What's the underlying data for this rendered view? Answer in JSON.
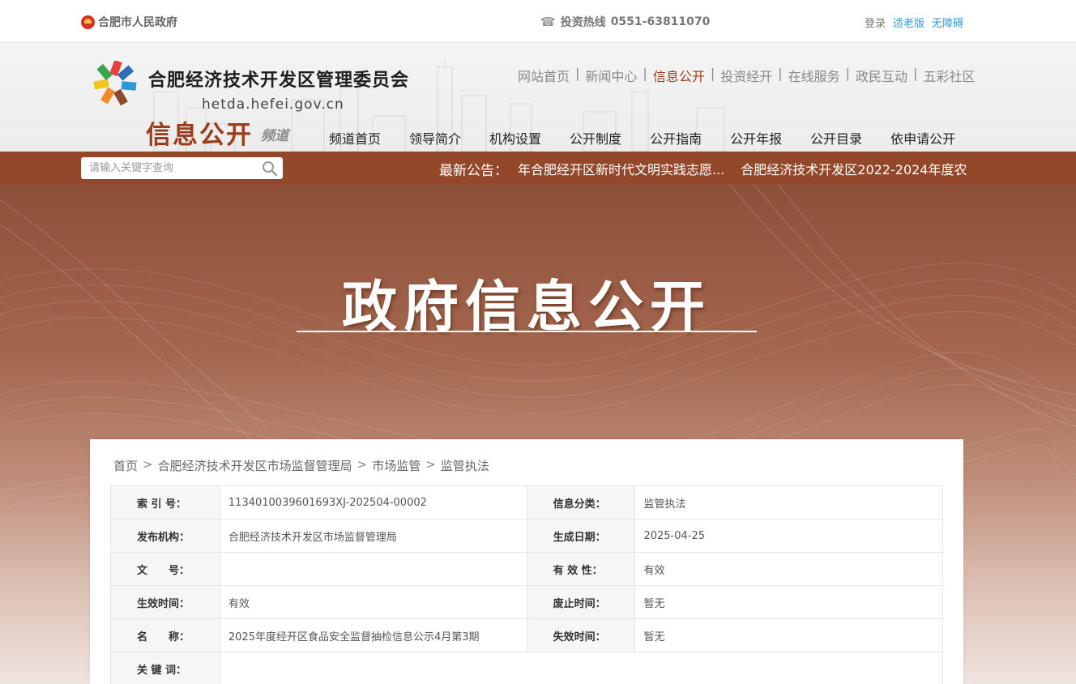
{
  "topbar": {
    "gov_link": "合肥市人民政府",
    "hotline_label": "投资热线",
    "hotline_number": "0551-63811070",
    "login": "登录",
    "elder": "适老版",
    "accessible": "无障碍"
  },
  "header": {
    "site_title": "合肥经济技术开发区管理委员会",
    "site_domain": "hetda.hefei.gov.cn",
    "channel_title": "信息公开",
    "channel_sub": "频道",
    "top_nav": [
      "网站首页",
      "新闻中心",
      "信息公开",
      "投资经开",
      "在线服务",
      "政民互动",
      "五彩社区"
    ],
    "top_nav_active": "信息公开",
    "main_nav": [
      "频道首页",
      "领导简介",
      "机构设置",
      "公开制度",
      "公开指南",
      "公开年报",
      "公开目录",
      "依申请公开"
    ]
  },
  "noticebar": {
    "search_placeholder": "请输入关键字查询",
    "label": "最新公告：",
    "items": [
      "年合肥经开区新时代文明实践志愿...",
      "合肥经济技术开发区2022-2024年度农"
    ]
  },
  "banner": {
    "title": "政府信息公开"
  },
  "breadcrumb": [
    "首页",
    "合肥经济技术开发区市场监督管理局",
    "市场监管",
    "监管执法"
  ],
  "meta": {
    "rows": [
      [
        {
          "k": "索 引 号：",
          "v": "1134010039601693XJ-202504-00002"
        },
        {
          "k": "信息分类：",
          "v": "监管执法"
        }
      ],
      [
        {
          "k": "发布机构：",
          "v": "合肥经济技术开发区市场监督管理局"
        },
        {
          "k": "生成日期：",
          "v": "2025-04-25"
        }
      ],
      [
        {
          "k": "文　　号：",
          "v": ""
        },
        {
          "k": "有 效 性：",
          "v": "有效"
        }
      ],
      [
        {
          "k": "生效时间：",
          "v": "有效"
        },
        {
          "k": "废止时间：",
          "v": "暂无"
        }
      ],
      [
        {
          "k": "名　　称：",
          "v": "2025年度经开区食品安全监督抽检信息公示4月第3期"
        },
        {
          "k": "失效时间：",
          "v": "暂无"
        }
      ],
      [
        {
          "k": "关 键 词：",
          "v": ""
        }
      ]
    ]
  },
  "colors": {
    "brand": "#94482a",
    "channel_title": "#9b3e1c",
    "link_blue": "#2a9bd6"
  }
}
